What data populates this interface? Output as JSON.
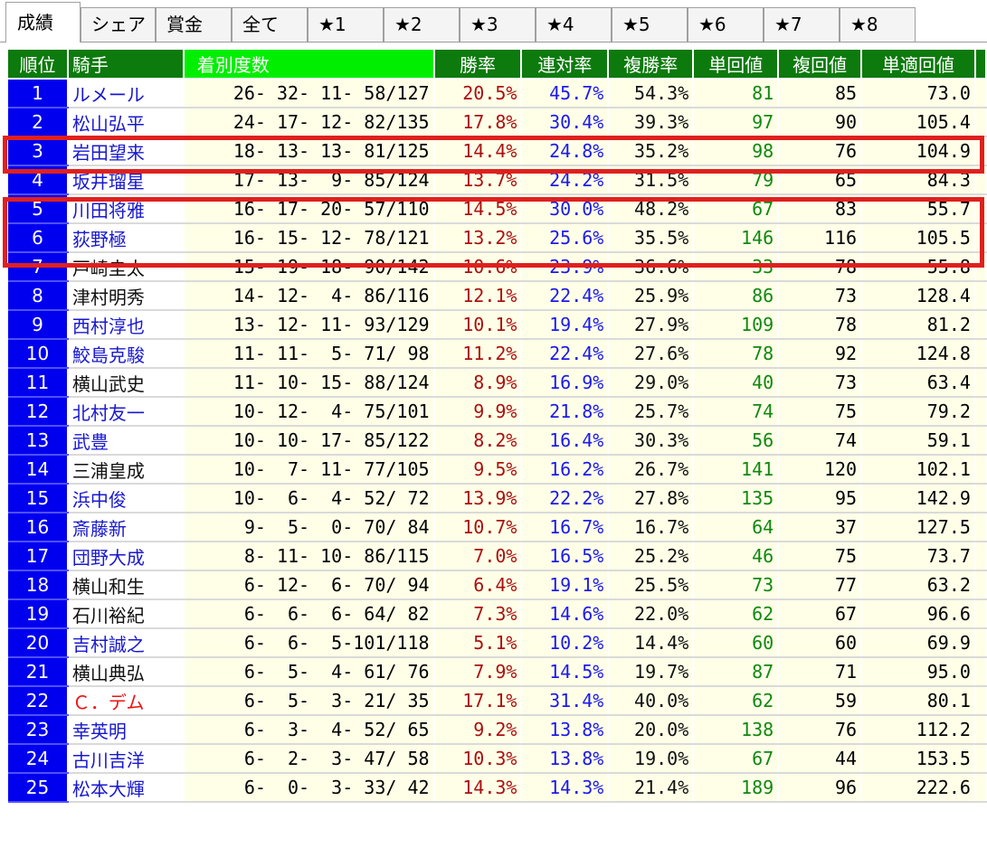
{
  "tabs": [
    "成績",
    "シェア",
    "賞金",
    "全て",
    "★1",
    "★2",
    "★3",
    "★4",
    "★5",
    "★6",
    "★7",
    "★8"
  ],
  "columns": [
    "順位",
    "騎手",
    "着別度数",
    "勝率",
    "連対率",
    "複勝率",
    "単回値",
    "複回値",
    "単適回値"
  ],
  "rows": [
    {
      "rank": "1",
      "name": "ルメール",
      "color": "blue",
      "record": "26- 32- 11- 58/127",
      "win": "20.5%",
      "ren": "45.7%",
      "fuku": "54.3%",
      "tan": "81",
      "fk": "85",
      "ta": "73.0"
    },
    {
      "rank": "2",
      "name": "松山弘平",
      "color": "blue",
      "record": "24- 17- 12- 82/135",
      "win": "17.8%",
      "ren": "30.4%",
      "fuku": "39.3%",
      "tan": "97",
      "fk": "90",
      "ta": "105.4"
    },
    {
      "rank": "3",
      "name": "岩田望来",
      "color": "blue",
      "record": "18- 13- 13- 81/125",
      "win": "14.4%",
      "ren": "24.8%",
      "fuku": "35.2%",
      "tan": "98",
      "fk": "76",
      "ta": "104.9"
    },
    {
      "rank": "4",
      "name": "坂井瑠星",
      "color": "blue",
      "record": "17- 13-  9- 85/124",
      "win": "13.7%",
      "ren": "24.2%",
      "fuku": "31.5%",
      "tan": "79",
      "fk": "65",
      "ta": "84.3"
    },
    {
      "rank": "5",
      "name": "川田将雅",
      "color": "blue",
      "record": "16- 17- 20- 57/110",
      "win": "14.5%",
      "ren": "30.0%",
      "fuku": "48.2%",
      "tan": "67",
      "fk": "83",
      "ta": "55.7"
    },
    {
      "rank": "6",
      "name": "荻野極",
      "color": "blue",
      "record": "16- 15- 12- 78/121",
      "win": "13.2%",
      "ren": "25.6%",
      "fuku": "35.5%",
      "tan": "146",
      "fk": "116",
      "ta": "105.5"
    },
    {
      "rank": "7",
      "name": "戸崎圭太",
      "color": "black",
      "record": "15- 19- 18- 90/142",
      "win": "10.6%",
      "ren": "23.9%",
      "fuku": "36.6%",
      "tan": "33",
      "fk": "78",
      "ta": "55.8"
    },
    {
      "rank": "8",
      "name": "津村明秀",
      "color": "black",
      "record": "14- 12-  4- 86/116",
      "win": "12.1%",
      "ren": "22.4%",
      "fuku": "25.9%",
      "tan": "86",
      "fk": "73",
      "ta": "128.4"
    },
    {
      "rank": "9",
      "name": "西村淳也",
      "color": "blue",
      "record": "13- 12- 11- 93/129",
      "win": "10.1%",
      "ren": "19.4%",
      "fuku": "27.9%",
      "tan": "109",
      "fk": "78",
      "ta": "81.2"
    },
    {
      "rank": "10",
      "name": "鮫島克駿",
      "color": "blue",
      "record": "11- 11-  5- 71/ 98",
      "win": "11.2%",
      "ren": "22.4%",
      "fuku": "27.6%",
      "tan": "78",
      "fk": "92",
      "ta": "124.8"
    },
    {
      "rank": "11",
      "name": "横山武史",
      "color": "black",
      "record": "11- 10- 15- 88/124",
      "win": "8.9%",
      "ren": "16.9%",
      "fuku": "29.0%",
      "tan": "40",
      "fk": "73",
      "ta": "63.4"
    },
    {
      "rank": "12",
      "name": "北村友一",
      "color": "blue",
      "record": "10- 12-  4- 75/101",
      "win": "9.9%",
      "ren": "21.8%",
      "fuku": "25.7%",
      "tan": "74",
      "fk": "75",
      "ta": "79.2"
    },
    {
      "rank": "13",
      "name": "武豊",
      "color": "blue",
      "record": "10- 10- 17- 85/122",
      "win": "8.2%",
      "ren": "16.4%",
      "fuku": "30.3%",
      "tan": "56",
      "fk": "74",
      "ta": "59.1"
    },
    {
      "rank": "14",
      "name": "三浦皇成",
      "color": "black",
      "record": "10-  7- 11- 77/105",
      "win": "9.5%",
      "ren": "16.2%",
      "fuku": "26.7%",
      "tan": "141",
      "fk": "120",
      "ta": "102.1"
    },
    {
      "rank": "15",
      "name": "浜中俊",
      "color": "blue",
      "record": "10-  6-  4- 52/ 72",
      "win": "13.9%",
      "ren": "22.2%",
      "fuku": "27.8%",
      "tan": "135",
      "fk": "95",
      "ta": "142.9"
    },
    {
      "rank": "16",
      "name": "斎藤新",
      "color": "blue",
      "record": " 9-  5-  0- 70/ 84",
      "win": "10.7%",
      "ren": "16.7%",
      "fuku": "16.7%",
      "tan": "64",
      "fk": "37",
      "ta": "127.5"
    },
    {
      "rank": "17",
      "name": "団野大成",
      "color": "blue",
      "record": " 8- 11- 10- 86/115",
      "win": "7.0%",
      "ren": "16.5%",
      "fuku": "25.2%",
      "tan": "46",
      "fk": "75",
      "ta": "73.7"
    },
    {
      "rank": "18",
      "name": "横山和生",
      "color": "black",
      "record": " 6- 12-  6- 70/ 94",
      "win": "6.4%",
      "ren": "19.1%",
      "fuku": "25.5%",
      "tan": "73",
      "fk": "77",
      "ta": "63.2"
    },
    {
      "rank": "19",
      "name": "石川裕紀",
      "color": "black",
      "record": " 6-  6-  6- 64/ 82",
      "win": "7.3%",
      "ren": "14.6%",
      "fuku": "22.0%",
      "tan": "62",
      "fk": "67",
      "ta": "96.6"
    },
    {
      "rank": "20",
      "name": "吉村誠之",
      "color": "blue",
      "record": " 6-  6-  5-101/118",
      "win": "5.1%",
      "ren": "10.2%",
      "fuku": "14.4%",
      "tan": "60",
      "fk": "60",
      "ta": "69.9"
    },
    {
      "rank": "21",
      "name": "横山典弘",
      "color": "black",
      "record": " 6-  5-  4- 61/ 76",
      "win": "7.9%",
      "ren": "14.5%",
      "fuku": "19.7%",
      "tan": "87",
      "fk": "71",
      "ta": "95.0"
    },
    {
      "rank": "22",
      "name": "Ｃ．デム",
      "color": "red",
      "record": " 6-  5-  3- 21/ 35",
      "win": "17.1%",
      "ren": "31.4%",
      "fuku": "40.0%",
      "tan": "62",
      "fk": "59",
      "ta": "80.1"
    },
    {
      "rank": "23",
      "name": "幸英明",
      "color": "blue",
      "record": " 6-  3-  4- 52/ 65",
      "win": "9.2%",
      "ren": "13.8%",
      "fuku": "20.0%",
      "tan": "138",
      "fk": "76",
      "ta": "112.2"
    },
    {
      "rank": "24",
      "name": "古川吉洋",
      "color": "blue",
      "record": " 6-  2-  3- 47/ 58",
      "win": "10.3%",
      "ren": "13.8%",
      "fuku": "19.0%",
      "tan": "67",
      "fk": "44",
      "ta": "153.5"
    },
    {
      "rank": "25",
      "name": "松本大輝",
      "color": "blue",
      "record": " 6-  0-  3- 33/ 42",
      "win": "14.3%",
      "ren": "14.3%",
      "fuku": "21.4%",
      "tan": "189",
      "fk": "96",
      "ta": "222.6"
    }
  ],
  "colors": {
    "header_green": "#0d7a0d",
    "header_bright": "#00ee00",
    "rank_blue": "#0000ee",
    "highlight_red": "#e0201e",
    "cell_bg": "#ffffe8"
  }
}
